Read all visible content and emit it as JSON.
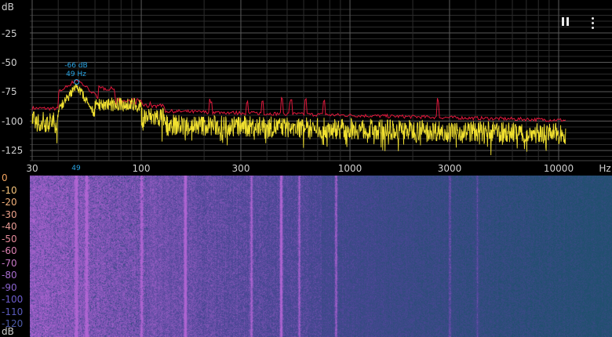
{
  "spectrum": {
    "y_unit": "dB",
    "x_unit": "Hz",
    "y_ticks": [
      "-25",
      "-50",
      "-75",
      "-100",
      "-125"
    ],
    "x_ticks": [
      "30",
      "100",
      "300",
      "1000",
      "3000",
      "10000"
    ],
    "peak": {
      "db_label": "-66 dB",
      "hz_label": "49 Hz",
      "x_marker": "49",
      "hz": 49,
      "db": -66
    },
    "colors": {
      "peak_hold": "#e0183c",
      "live": "#f0e030",
      "marker": "#2aa6e6"
    }
  },
  "controls": {
    "pause_icon": "pause-icon",
    "more_icon": "more-vert-icon"
  },
  "spectrogram": {
    "scale": [
      {
        "label": "0",
        "color": "#f2a25e"
      },
      {
        "label": "-10",
        "color": "#f5c37a"
      },
      {
        "label": "-20",
        "color": "#f2b07a"
      },
      {
        "label": "-30",
        "color": "#eba08a"
      },
      {
        "label": "-40",
        "color": "#e79a93"
      },
      {
        "label": "-50",
        "color": "#e58a9a"
      },
      {
        "label": "-60",
        "color": "#db80b2"
      },
      {
        "label": "-70",
        "color": "#c777c6"
      },
      {
        "label": "-80",
        "color": "#a76ccd"
      },
      {
        "label": "-90",
        "color": "#8a63cf"
      },
      {
        "label": "-100",
        "color": "#6d5ccc"
      },
      {
        "label": "-110",
        "color": "#5a5bbd"
      },
      {
        "label": "-120",
        "color": "#4d5aa8"
      }
    ],
    "scale_unit": "dB"
  }
}
